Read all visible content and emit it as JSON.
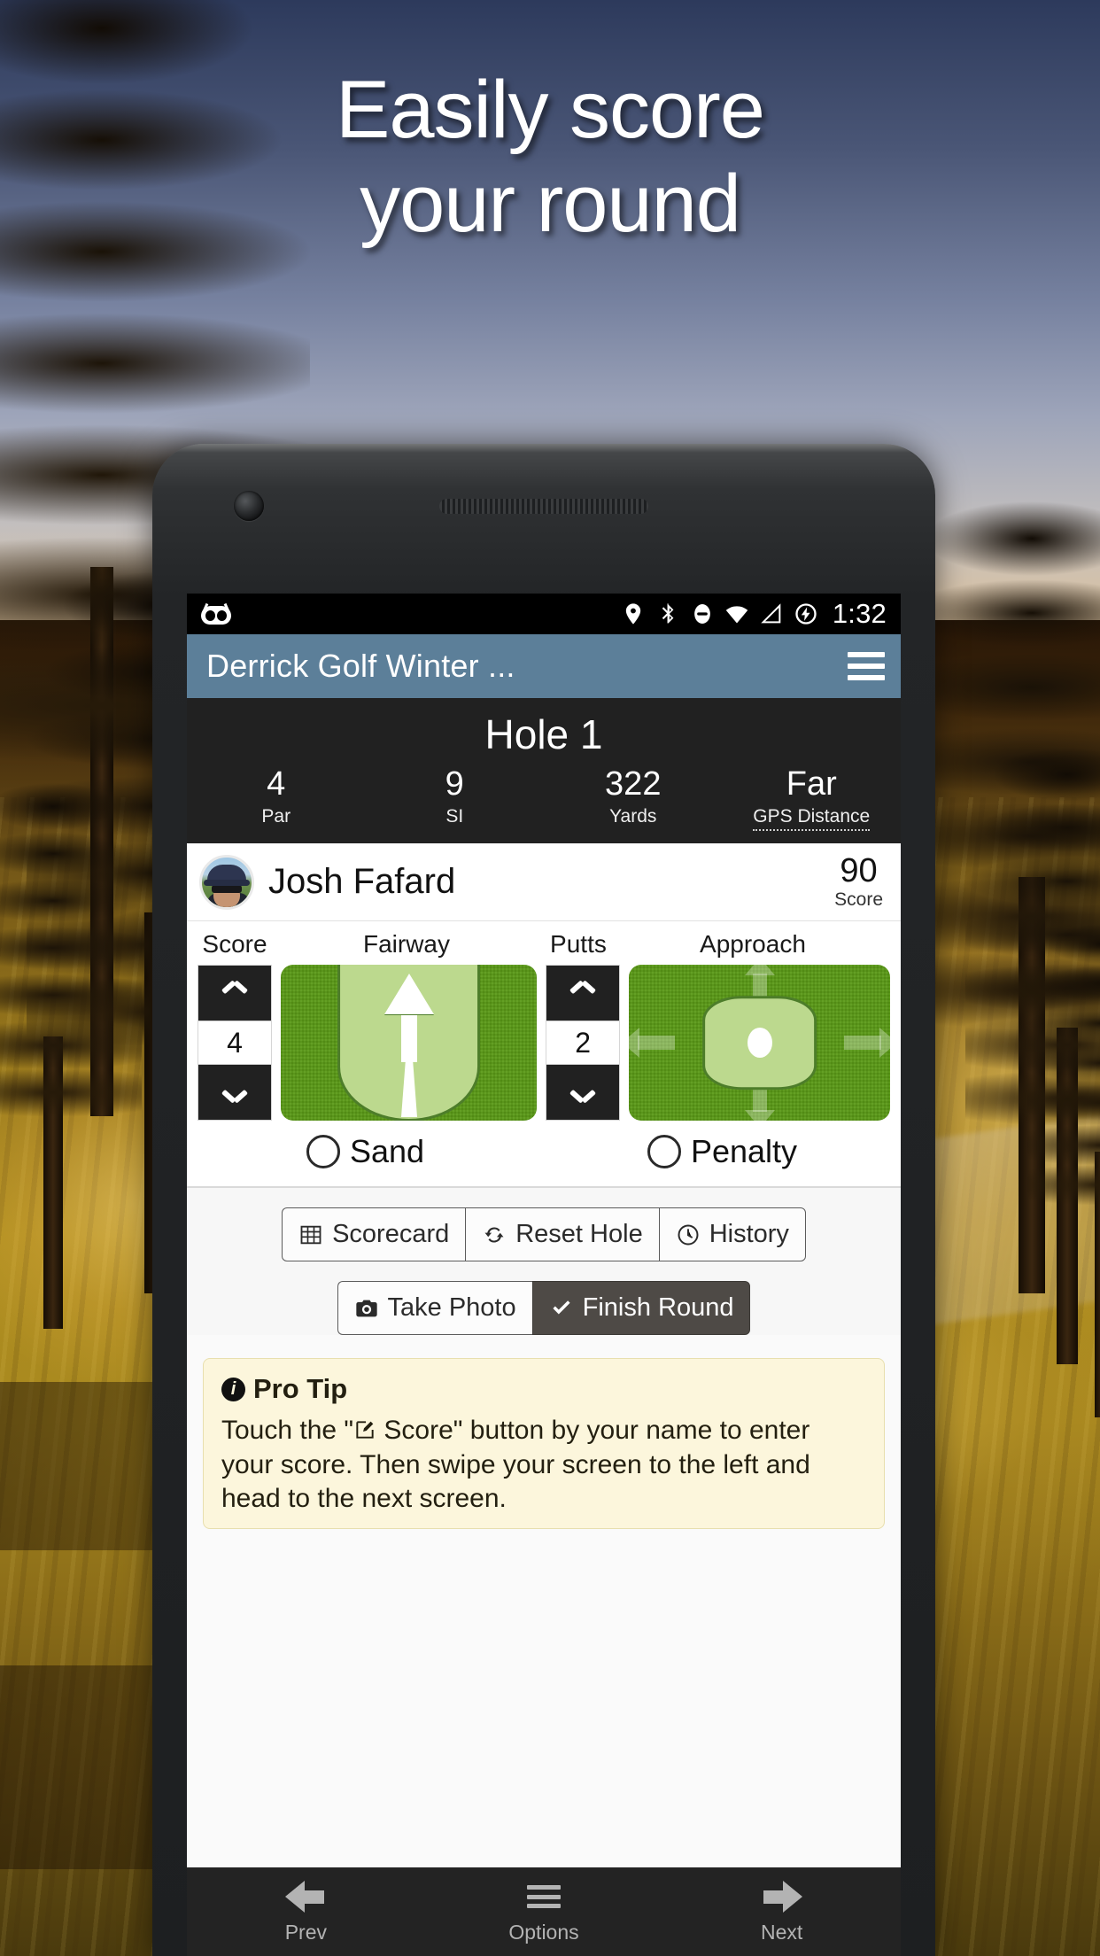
{
  "promo": {
    "headline_line1": "Easily score",
    "headline_line2": "your round"
  },
  "statusbar": {
    "time": "1:32",
    "icons": [
      "cyanogenmod-logo",
      "location-icon",
      "bluetooth-icon",
      "do-not-disturb-icon",
      "wifi-icon",
      "cell-signal-icon",
      "battery-charging-icon"
    ]
  },
  "actionbar": {
    "title": "Derrick Golf Winter ...",
    "menu_icon": "hamburger-menu-icon"
  },
  "hole": {
    "title": "Hole 1",
    "stats": [
      {
        "value": "4",
        "label": "Par"
      },
      {
        "value": "9",
        "label": "SI"
      },
      {
        "value": "322",
        "label": "Yards"
      },
      {
        "value": "Far",
        "label": "GPS Distance"
      }
    ]
  },
  "player": {
    "name": "Josh Fafard",
    "score_value": "90",
    "score_label": "Score"
  },
  "entry": {
    "headers": {
      "score": "Score",
      "fairway": "Fairway",
      "putts": "Putts",
      "approach": "Approach"
    },
    "score_value": "4",
    "putts_value": "2",
    "fairway_state": "straight",
    "approach_state": "center"
  },
  "checks": {
    "sand_label": "Sand",
    "sand_checked": false,
    "penalty_label": "Penalty",
    "penalty_checked": false
  },
  "toolbar": {
    "scorecard_label": "Scorecard",
    "reset_hole_label": "Reset Hole",
    "history_label": "History",
    "take_photo_label": "Take Photo",
    "finish_round_label": "Finish Round"
  },
  "protip": {
    "title": "Pro Tip",
    "text_before": "Touch the \"",
    "text_after": " Score\" button by your name to enter your score. Then swipe your screen to the left and head to the next screen."
  },
  "bottomnav": {
    "prev_label": "Prev",
    "options_label": "Options",
    "next_label": "Next"
  },
  "colors": {
    "actionbar": "#5c7f99",
    "dark_panel": "#212121",
    "green": "#5a9a16",
    "green_light": "#bcd98e",
    "tip_bg": "#fcf6dc",
    "finish_btn": "#4e4a46"
  }
}
